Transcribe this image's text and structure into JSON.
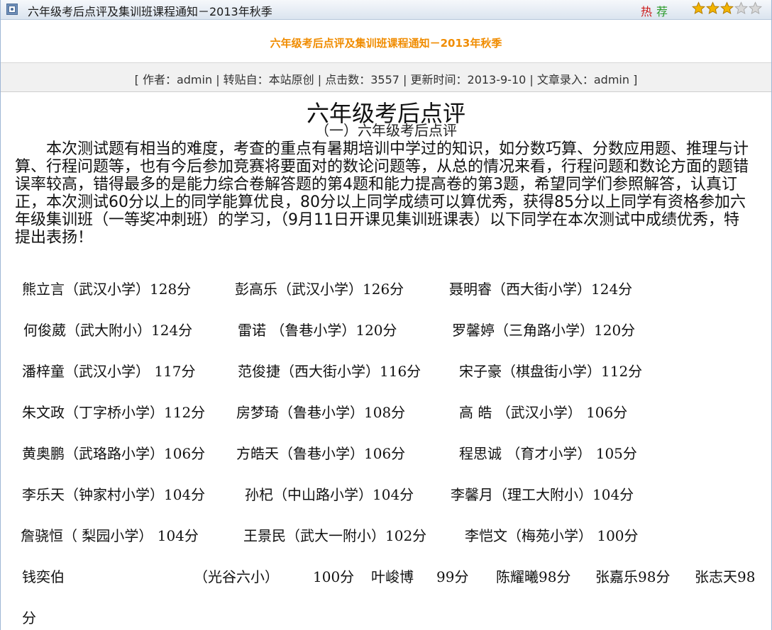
{
  "titlebar": {
    "title": "六年级考后点评及集训班课程通知－2013年秋季",
    "hot": "热",
    "recommend": "荐",
    "rating": 3,
    "rating_max": 5,
    "colors": {
      "hot": "#cc1a1a",
      "recommend": "#2a9a2a",
      "star_on": "#f2b400",
      "star_off": "#d8d8d8"
    }
  },
  "banner": {
    "title": "六年级考后点评及集训班课程通知－2013年秋季",
    "color": "#f08c00"
  },
  "info": {
    "text": "[ 作者：admin | 转贴自：本站原创 | 点击数：3557 | 更新时间：2013-9-10 | 文章录入：admin ]"
  },
  "article": {
    "heading": "六年级考后点评",
    "subheading": "（一）六年级考后点评",
    "paragraph": "本次测试题有相当的难度，考查的重点有暑期培训中学过的知识，如分数巧算、分数应用题、推理与计算、行程问题等，也有今后参加竞赛将要面对的数论问题等，从总的情况来看，行程问题和数论方面的题错误率较高，错得最多的是能力综合卷解答题的第4题和能力提高卷的第3题，希望同学们参照解答，认真订正，本次测试60分以上的同学能算优良，80分以上同学成绩可以算优秀，获得85分以上同学有资格参加六年级集训班（一等奖冲刺班）的学习，（9月11日开课见集训班课表）以下同学在本次测试中成绩优秀，特提出表扬！",
    "rows": [
      [
        "熊立言（武汉小学）128分",
        "彭高乐（武汉小学）126分",
        "聂明睿（西大街小学）124分"
      ],
      [
        "何俊葳（武大附小）124分",
        "雷诺 （鲁巷小学）120分",
        "罗馨婷（三角路小学）120分"
      ],
      [
        "潘梓童（武汉小学） 117分",
        "范俊捷（西大街小学）116分",
        "宋子豪（棋盘街小学）112分"
      ],
      [
        "朱文政（丁字桥小学）112分",
        "房梦琦（鲁巷小学）108分",
        "高 皓 （武汉小学）  106分"
      ],
      [
        "黄奥鹏（武珞路小学）106分",
        "方皓天（鲁巷小学）106分",
        "程思诚 （育才小学）  105分"
      ],
      [
        "李乐天（钟家村小学）104分",
        "孙杞（中山路小学）104分",
        "李馨月（理工大附小）104分"
      ],
      [
        "詹骁恒（ 梨园小学） 104分",
        "王景民（武大一附小）102分",
        "李恺文（梅苑小学）  100分"
      ],
      [
        "钱奕伯",
        "（光谷六小）",
        "100分",
        "叶峻博",
        "99分",
        "陈耀曦98分",
        "张嘉乐98分",
        "张志天98"
      ],
      [
        "分"
      ]
    ]
  }
}
